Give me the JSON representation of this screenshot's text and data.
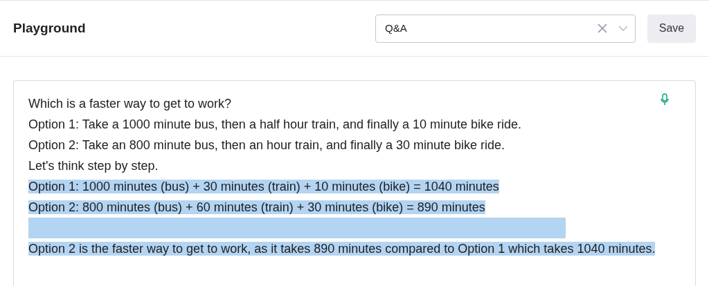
{
  "header": {
    "title": "Playground",
    "preset_select": {
      "value": "Q&A"
    },
    "save_button": "Save"
  },
  "editor": {
    "lines": [
      {
        "kind": "text",
        "text": "Which is a faster way to get to work?",
        "selected": false
      },
      {
        "kind": "text",
        "text": "Option 1: Take a 1000 minute bus, then a half hour train, and finally a 10 minute bike ride.",
        "selected": false
      },
      {
        "kind": "text",
        "text": "Option 2: Take an 800 minute bus, then an hour train, and finally a 30 minute bike ride.",
        "selected": false
      },
      {
        "kind": "text",
        "text": "Let's think step by step.",
        "selected": false
      },
      {
        "kind": "text",
        "text": "Option 1: 1000 minutes (bus) + 30 minutes (train) + 10 minutes (bike) = 1040 minutes",
        "selected": true
      },
      {
        "kind": "text",
        "text": "Option 2: 800 minutes (bus) + 60 minutes (train) + 30 minutes (bike) = 890 minutes",
        "selected": true
      },
      {
        "kind": "blank",
        "selected": true
      },
      {
        "kind": "text",
        "text": "Option 2 is the faster way to get to work, as it takes 890 minutes compared to Option 1 which takes 1040 minutes.",
        "selected": true
      }
    ]
  }
}
